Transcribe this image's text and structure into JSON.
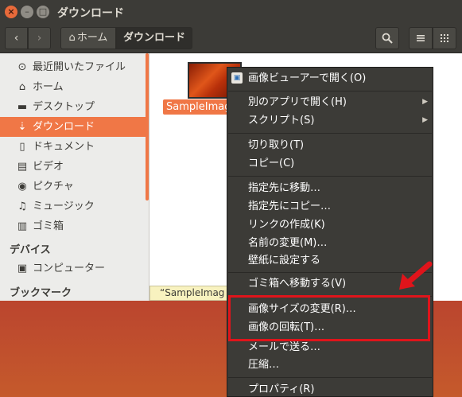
{
  "window": {
    "title": "ダウンロード"
  },
  "toolbar": {
    "back_icon": "‹",
    "forward_icon": "›",
    "home_label": "ホーム",
    "current_label": "ダウンロード",
    "search_icon": "search-icon",
    "list_icon": "list-view-icon",
    "grid_icon": "grid-view-icon"
  },
  "sidebar": {
    "items": [
      {
        "label": "最近開いたファイル",
        "icon": "⊙"
      },
      {
        "label": "ホーム",
        "icon": "⌂"
      },
      {
        "label": "デスクトップ",
        "icon": "▬"
      },
      {
        "label": "ダウンロード",
        "icon": "⇣"
      },
      {
        "label": "ドキュメント",
        "icon": "▯"
      },
      {
        "label": "ビデオ",
        "icon": "▤"
      },
      {
        "label": "ピクチャ",
        "icon": "◉"
      },
      {
        "label": "ミュージック",
        "icon": "♫"
      },
      {
        "label": "ゴミ箱",
        "icon": "▥"
      }
    ],
    "devices_heading": "デバイス",
    "devices": [
      {
        "label": "コンピューター",
        "icon": "▣"
      }
    ],
    "bookmarks_heading": "ブックマーク"
  },
  "files": [
    {
      "name": "SampleImage"
    }
  ],
  "tooltip": {
    "text": "“SampleImag"
  },
  "context_menu": {
    "open_with_default": "画像ビューアーで開く(O)",
    "open_with_other": "別のアプリで開く(H)",
    "scripts": "スクリプト(S)",
    "cut": "切り取り(T)",
    "copy": "コピー(C)",
    "move_to": "指定先に移動…",
    "copy_to": "指定先にコピー…",
    "make_link": "リンクの作成(K)",
    "rename": "名前の変更(M)…",
    "set_wallpaper": "壁紙に設定する",
    "move_to_trash": "ゴミ箱へ移動する(V)",
    "resize_image": "画像サイズの変更(R)…",
    "rotate_image": "画像の回転(T)…",
    "send_mail": "メールで送る…",
    "compress": "圧縮…",
    "properties": "プロパティ(R)"
  },
  "annotation": {
    "highlight_color": "#e0141b"
  },
  "colors": {
    "accent": "#f07746",
    "chrome": "#3c3b37"
  }
}
